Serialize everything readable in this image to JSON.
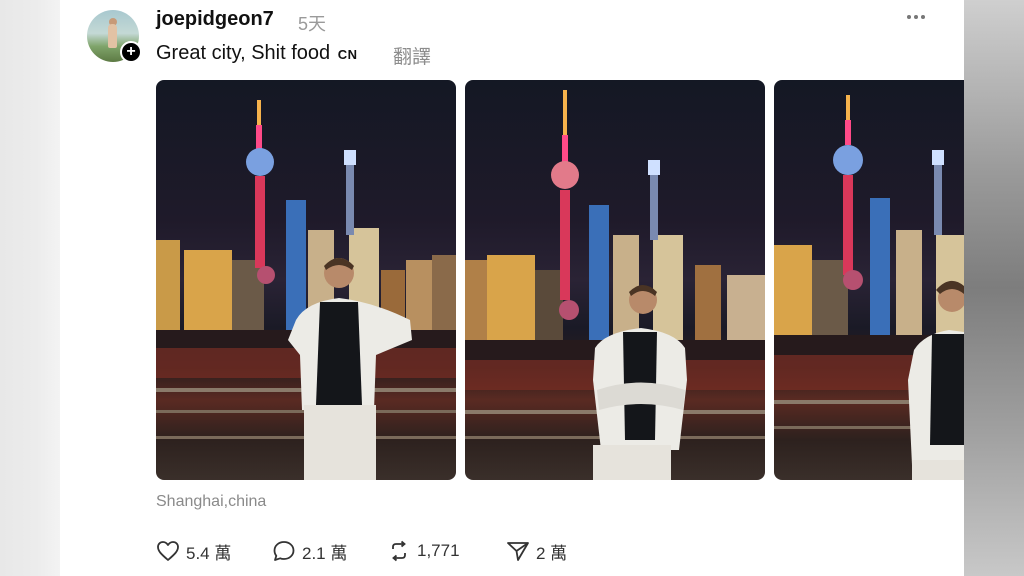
{
  "post": {
    "username": "joepidgeon7",
    "timestamp": "5天",
    "more_icon": "ellipsis-icon",
    "caption_text": "Great city, Shit food",
    "caption_badge": "CN",
    "translate_label": "翻譯",
    "location": "Shanghai,china",
    "photos": [
      {
        "alt": "Man in white jacket with hands on hips in front of Shanghai skyline at night"
      },
      {
        "alt": "Man with arms crossed in front of Oriental Pearl Tower at night"
      },
      {
        "alt": "Man in white jacket smiling in front of Shanghai skyline at night"
      }
    ]
  },
  "actions": {
    "likes": "5.4 萬",
    "replies": "2.1 萬",
    "reposts": "1,771",
    "shares": "2 萬"
  },
  "colors": {
    "text": "#111111",
    "muted": "#8c8c8c",
    "tower_pink": "#e0447c",
    "building_gold": "#d9a44a"
  }
}
